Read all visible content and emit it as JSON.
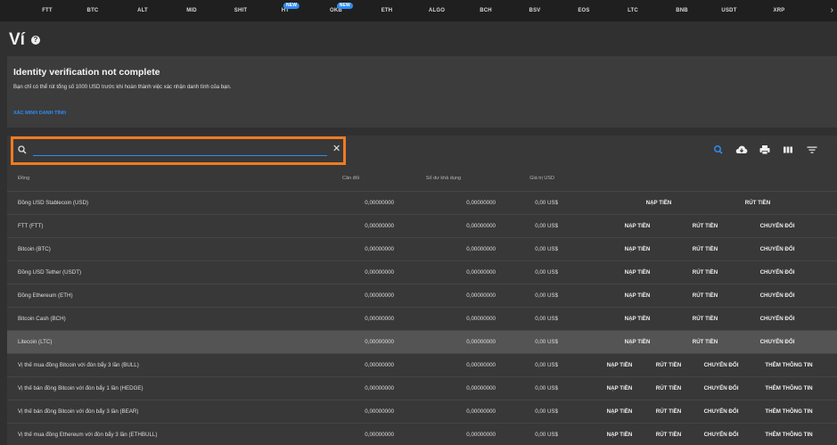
{
  "nav": {
    "tabs": [
      {
        "label": "FTT"
      },
      {
        "label": "BTC"
      },
      {
        "label": "ALT"
      },
      {
        "label": "MID"
      },
      {
        "label": "SHIT"
      },
      {
        "label": "HT",
        "badge": "NEW"
      },
      {
        "label": "OKB",
        "badge": "NEW"
      },
      {
        "label": "ETH"
      },
      {
        "label": "ALGO"
      },
      {
        "label": "BCH"
      },
      {
        "label": "BSV"
      },
      {
        "label": "EOS"
      },
      {
        "label": "LTC"
      },
      {
        "label": "BNB"
      },
      {
        "label": "USDT"
      },
      {
        "label": "XRP"
      }
    ],
    "more_icon": "chevron-right-icon",
    "more_glyph": "›"
  },
  "page": {
    "title": "Ví",
    "help_glyph": "?"
  },
  "banner": {
    "title": "Identity verification not complete",
    "text": "Bạn chỉ có thể rút tổng số 1000 USD trước khi hoàn thành việc xác nhận danh tính của bạn.",
    "link": "XÁC MINH DANH TÍNH"
  },
  "search": {
    "value": "",
    "placeholder": "",
    "clear_glyph": "✕"
  },
  "toolbar": {
    "icons": [
      "search-icon",
      "cloud-download-icon",
      "print-icon",
      "view-columns-icon",
      "filter-icon"
    ],
    "accent": "#2f8cf0"
  },
  "table": {
    "headers": {
      "coin": "Đồng",
      "balance": "Cân đối",
      "available": "Số dư khả dụng",
      "value": "Giá trị USD"
    },
    "rows": [
      {
        "name": "Đồng USD Stablecoin (USD)",
        "balance": "0,00000000",
        "available": "0,00000000",
        "value": "0,00 US$",
        "actions": [
          "NẠP TIỀN",
          "RÚT TIỀN"
        ]
      },
      {
        "name": "FTT (FTT)",
        "balance": "0,00000000",
        "available": "0,00000000",
        "value": "0,00 US$",
        "actions": [
          "NẠP TIỀN",
          "RÚT TIỀN",
          "CHUYỂN ĐỔI"
        ]
      },
      {
        "name": "Bitcoin (BTC)",
        "balance": "0,00000000",
        "available": "0,00000000",
        "value": "0,00 US$",
        "actions": [
          "NẠP TIỀN",
          "RÚT TIỀN",
          "CHUYỂN ĐỔI"
        ]
      },
      {
        "name": "Đồng USD Tether (USDT)",
        "balance": "0,00000000",
        "available": "0,00000000",
        "value": "0,00 US$",
        "actions": [
          "NẠP TIỀN",
          "RÚT TIỀN",
          "CHUYỂN ĐỔI"
        ]
      },
      {
        "name": "Đồng Ethereum (ETH)",
        "balance": "0,00000000",
        "available": "0,00000000",
        "value": "0,00 US$",
        "actions": [
          "NẠP TIỀN",
          "RÚT TIỀN",
          "CHUYỂN ĐỔI"
        ]
      },
      {
        "name": "Bitcoin Cash (BCH)",
        "balance": "0,00000000",
        "available": "0,00000000",
        "value": "0,00 US$",
        "actions": [
          "NẠP TIỀN",
          "RÚT TIỀN",
          "CHUYỂN ĐỔI"
        ]
      },
      {
        "name": "Litecoin (LTC)",
        "balance": "0,00000000",
        "available": "0,00000000",
        "value": "0,00 US$",
        "actions": [
          "NẠP TIỀN",
          "RÚT TIỀN",
          "CHUYỂN ĐỔI"
        ]
      },
      {
        "name": "Vị thế mua đồng Bitcoin với đòn bẩy 3 lần (BULL)",
        "balance": "0,00000000",
        "available": "0,00000000",
        "value": "0,00 US$",
        "actions": [
          "NẠP TIỀN",
          "RÚT TIỀN",
          "CHUYỂN ĐỔI",
          "THÊM THÔNG TIN"
        ]
      },
      {
        "name": "Vị thế bán đồng Bitcoin với đòn bẩy 1 lần (HEDGE)",
        "balance": "0,00000000",
        "available": "0,00000000",
        "value": "0,00 US$",
        "actions": [
          "NẠP TIỀN",
          "RÚT TIỀN",
          "CHUYỂN ĐỔI",
          "THÊM THÔNG TIN"
        ]
      },
      {
        "name": "Vị thế bán đồng Bitcoin với đòn bẩy 3 lần (BEAR)",
        "balance": "0,00000000",
        "available": "0,00000000",
        "value": "0,00 US$",
        "actions": [
          "NẠP TIỀN",
          "RÚT TIỀN",
          "CHUYỂN ĐỔI",
          "THÊM THÔNG TIN"
        ]
      },
      {
        "name": "Vị thế mua đồng Ethereum với đòn bẩy 3 lần (ETHBULL)",
        "balance": "0,00000000",
        "available": "0,00000000",
        "value": "0,00 US$",
        "actions": [
          "NẠP TIỀN",
          "RÚT TIỀN",
          "CHUYỂN ĐỔI",
          "THÊM THÔNG TIN"
        ]
      }
    ],
    "highlighted_row": 6
  }
}
